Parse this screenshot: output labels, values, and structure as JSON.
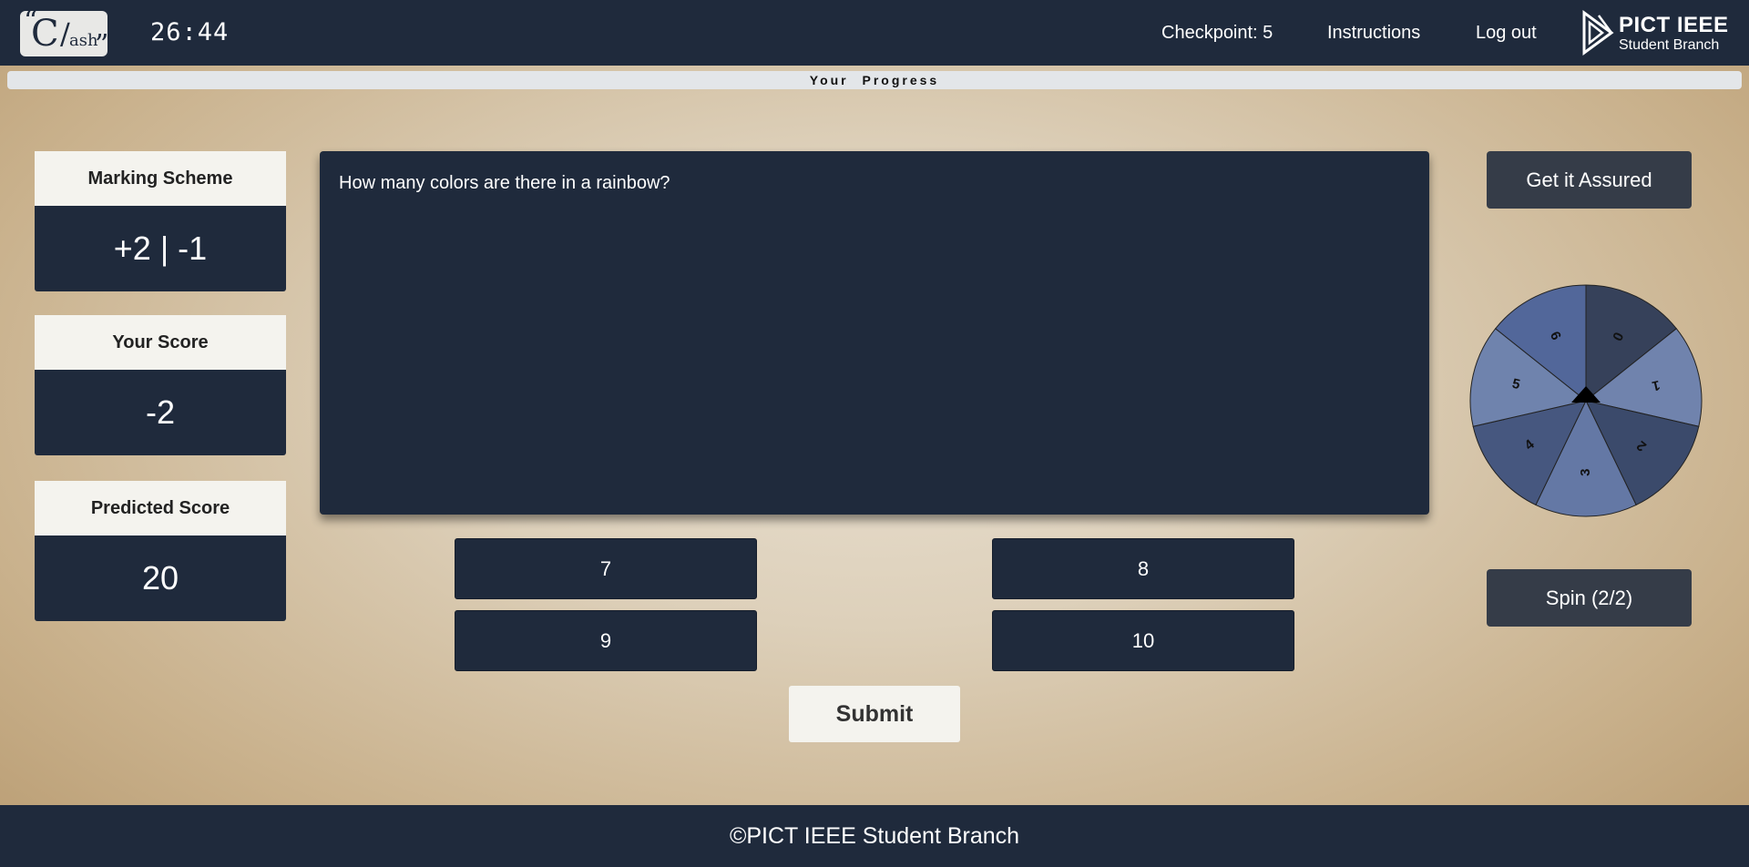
{
  "header": {
    "logo_text": "C/ash",
    "timer": "26:44",
    "checkpoint": "Checkpoint: 5",
    "instructions_label": "Instructions",
    "logout_label": "Log out",
    "brand_title": "PICT IEEE",
    "brand_subtitle": "Student Branch"
  },
  "progress": {
    "label": "Your Progress",
    "value_percent": 0
  },
  "cards": {
    "marking_scheme": {
      "title": "Marking Scheme",
      "value": "+2 | -1"
    },
    "score": {
      "title": "Your Score",
      "value": "-2"
    },
    "predicted": {
      "title": "Predicted Score",
      "value": "20"
    }
  },
  "question": {
    "text": "How many colors are there in a rainbow?",
    "options": [
      "7",
      "8",
      "9",
      "10"
    ]
  },
  "submit_label": "Submit",
  "lifelines": {
    "assure_label": "Get it Assured",
    "spin_label": "Spin (2/2)",
    "wheel_segments": [
      "0",
      "1",
      "2",
      "3",
      "4",
      "5",
      "6"
    ],
    "wheel_colors": [
      "#36415a",
      "#7083ad",
      "#3b4a6b",
      "#6478a5",
      "#46577f",
      "#6f83ad",
      "#52679a"
    ]
  },
  "footer": {
    "text": "©PICT IEEE Student Branch"
  }
}
